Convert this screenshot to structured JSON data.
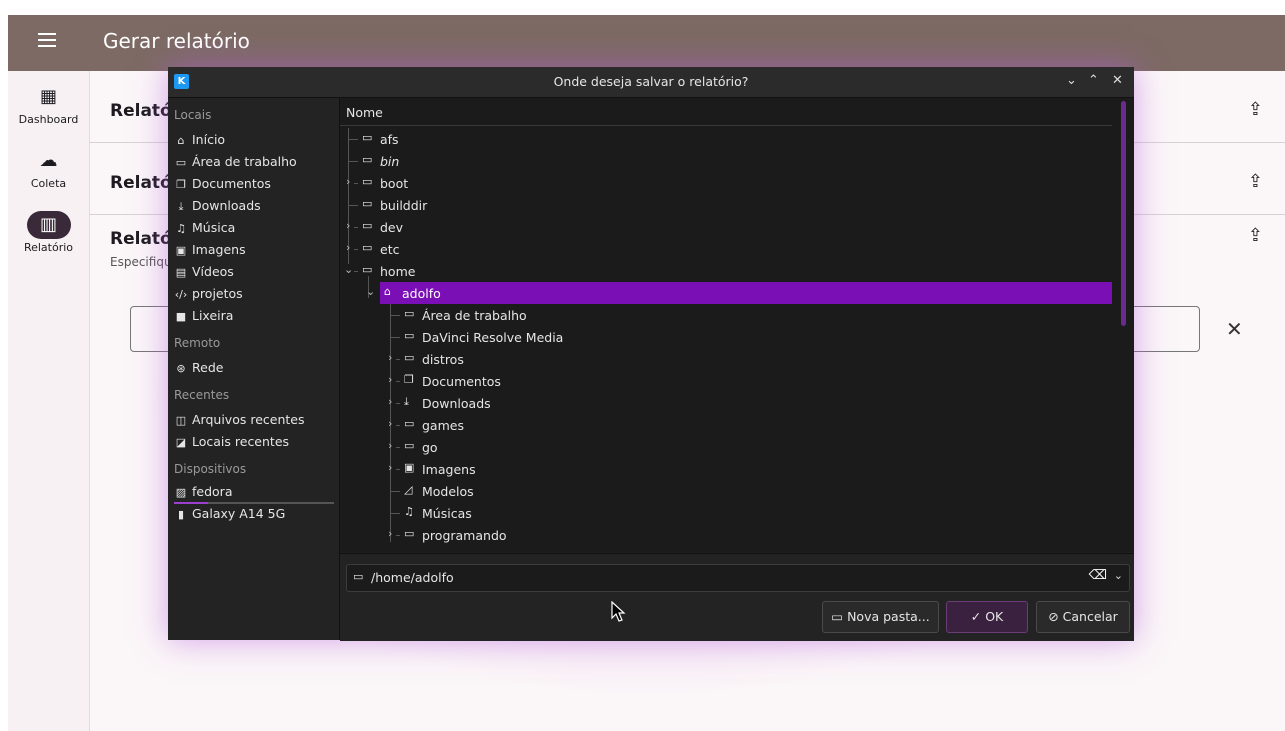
{
  "app": {
    "title": "Gerar relatório",
    "nav": [
      {
        "label": "Dashboard",
        "icon": "dashboard-icon"
      },
      {
        "label": "Coleta",
        "icon": "cloud-upload-icon"
      },
      {
        "label": "Relatório",
        "icon": "chart-icon"
      }
    ],
    "cards": [
      {
        "title": "Relatório"
      },
      {
        "title": "Relatório"
      },
      {
        "title": "Relatório",
        "subtitle": "Especifique"
      }
    ]
  },
  "dialog": {
    "title": "Onde deseja salvar o relatório?",
    "places": {
      "sections": [
        "Locais",
        "Remoto",
        "Recentes",
        "Dispositivos"
      ],
      "locais": [
        "Início",
        "Área de trabalho",
        "Documentos",
        "Downloads",
        "Música",
        "Imagens",
        "Vídeos",
        "projetos",
        "Lixeira"
      ],
      "remoto": [
        "Rede"
      ],
      "recentes": [
        "Arquivos recentes",
        "Locais recentes"
      ],
      "dispositivos": [
        "fedora",
        "Galaxy A14 5G"
      ]
    },
    "tree": {
      "header": "Nome",
      "rows": [
        {
          "label": "afs"
        },
        {
          "label": "bin"
        },
        {
          "label": "boot"
        },
        {
          "label": "builddir"
        },
        {
          "label": "dev"
        },
        {
          "label": "etc"
        },
        {
          "label": "home"
        },
        {
          "label": "adolfo"
        },
        {
          "label": "Área de trabalho"
        },
        {
          "label": "DaVinci Resolve Media"
        },
        {
          "label": "distros"
        },
        {
          "label": "Documentos"
        },
        {
          "label": "Downloads"
        },
        {
          "label": "games"
        },
        {
          "label": "go"
        },
        {
          "label": "Imagens"
        },
        {
          "label": "Modelos"
        },
        {
          "label": "Músicas"
        },
        {
          "label": "programando"
        }
      ]
    },
    "path": "/home/adolfo",
    "buttons": {
      "new_folder": "Nova pasta...",
      "ok": "OK",
      "cancel": "Cancelar"
    }
  }
}
